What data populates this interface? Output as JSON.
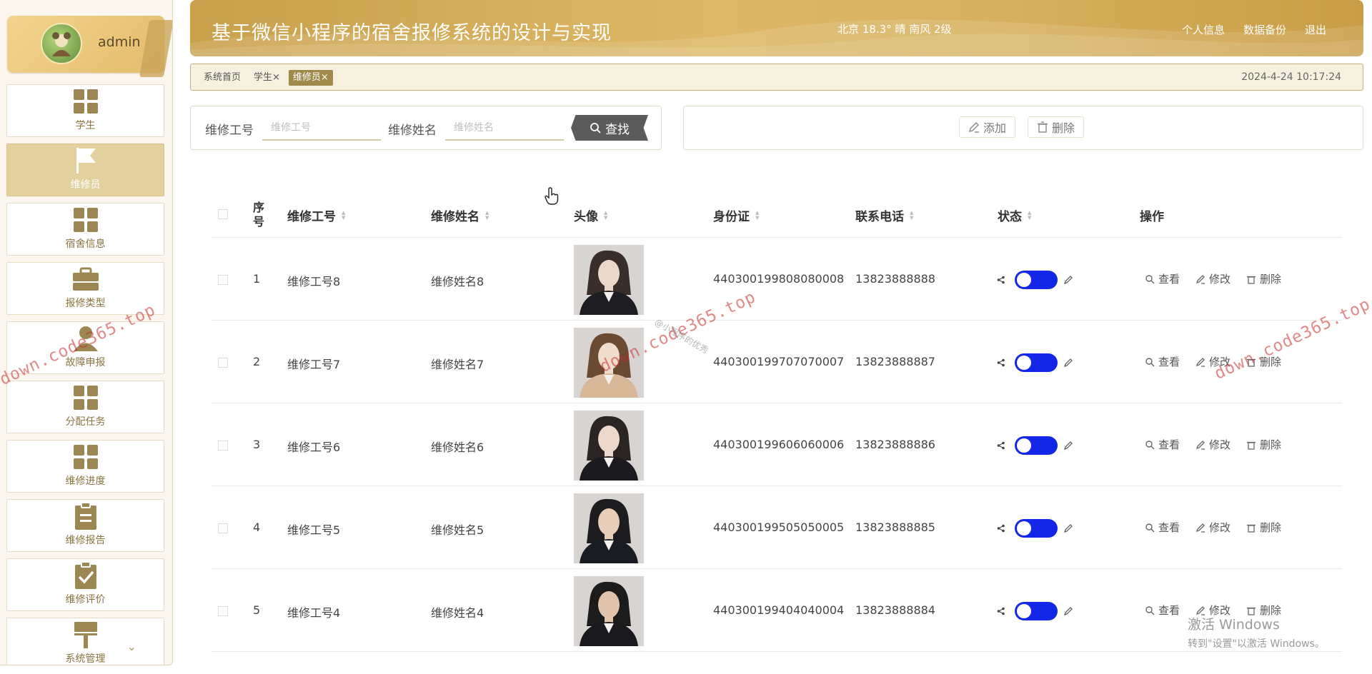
{
  "app": {
    "title": "基于微信小程序的宿舍报修系统的设计与实现",
    "weather": "北京  18.3°  晴  南风  2级",
    "header_links": [
      "个人信息",
      "数据备份",
      "退出"
    ]
  },
  "user": {
    "name": "admin"
  },
  "sidebar": {
    "items": [
      {
        "label": "学生",
        "icon": "grid-icon"
      },
      {
        "label": "维修员",
        "icon": "flag-icon",
        "active": true
      },
      {
        "label": "宿舍信息",
        "icon": "grid-icon"
      },
      {
        "label": "报修类型",
        "icon": "briefcase-icon"
      },
      {
        "label": "故障申报",
        "icon": "user-icon"
      },
      {
        "label": "分配任务",
        "icon": "grid-icon"
      },
      {
        "label": "维修进度",
        "icon": "grid-icon"
      },
      {
        "label": "维修报告",
        "icon": "clipboard-icon"
      },
      {
        "label": "维修评价",
        "icon": "clipboard-check-icon"
      },
      {
        "label": "系统管理",
        "icon": "sign-icon"
      }
    ]
  },
  "tabs": [
    {
      "label": "系统首页"
    },
    {
      "label": "学生×"
    },
    {
      "label": "维修员×",
      "active": true
    }
  ],
  "clock": "2024-4-24 10:17:24",
  "search": {
    "field1_label": "维修工号",
    "field1_placeholder": "维修工号",
    "field2_label": "维修姓名",
    "field2_placeholder": "维修姓名",
    "button": "查找"
  },
  "actions": {
    "add": "添加",
    "delete": "删除"
  },
  "table": {
    "headers": {
      "seq": "序号",
      "worker_id": "维修工号",
      "worker_name": "维修姓名",
      "avatar": "头像",
      "id_card": "身份证",
      "phone": "联系电话",
      "status": "状态",
      "ops": "操作"
    },
    "ops": {
      "view": "查看",
      "edit": "修改",
      "delete": "删除"
    },
    "rows": [
      {
        "seq": "1",
        "worker_id": "维修工号8",
        "worker_name": "维修姓名8",
        "id_card": "440300199808080008",
        "phone": "13823888888",
        "status_on": true
      },
      {
        "seq": "2",
        "worker_id": "维修工号7",
        "worker_name": "维修姓名7",
        "id_card": "440300199707070007",
        "phone": "13823888887",
        "status_on": true
      },
      {
        "seq": "3",
        "worker_id": "维修工号6",
        "worker_name": "维修姓名6",
        "id_card": "440300199606060006",
        "phone": "13823888886",
        "status_on": true
      },
      {
        "seq": "4",
        "worker_id": "维修工号5",
        "worker_name": "维修姓名5",
        "id_card": "440300199505050005",
        "phone": "13823888885",
        "status_on": true
      },
      {
        "seq": "5",
        "worker_id": "维修工号4",
        "worker_name": "维修姓名4",
        "id_card": "440300199404040004",
        "phone": "13823888884",
        "status_on": true
      }
    ]
  },
  "overlays": {
    "watermark": "down.code365.top",
    "watermark_small": "@小程序的优秀",
    "activate_title": "激活 Windows",
    "activate_sub": "转到\"设置\"以激活 Windows。"
  },
  "colors": {
    "accent": "#c9a04b",
    "toggle": "#1426e6",
    "active_menu": "#e2d09f"
  }
}
